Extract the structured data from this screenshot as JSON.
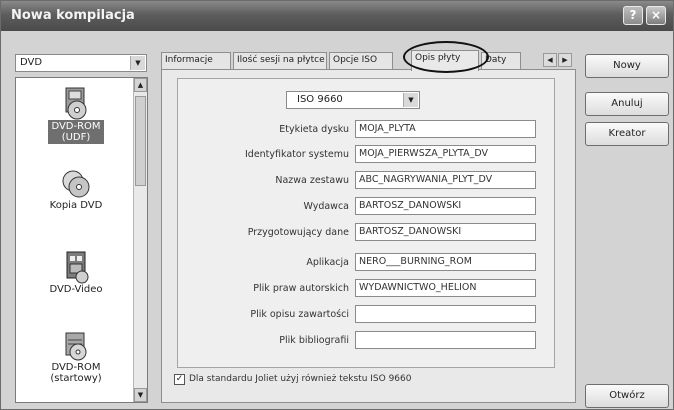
{
  "window": {
    "title": "Nowa kompilacja"
  },
  "disc_type": {
    "value": "DVD"
  },
  "compilation_types": [
    {
      "label_line1": "DVD-ROM",
      "label_line2": "(UDF)",
      "selected": true
    },
    {
      "label_line1": "Kopia DVD",
      "label_line2": ""
    },
    {
      "label_line1": "DVD-Video",
      "label_line2": ""
    },
    {
      "label_line1": "DVD-ROM",
      "label_line2": "(startowy)"
    }
  ],
  "tabs": [
    {
      "label": "Informacje"
    },
    {
      "label": "Ilość sesji na płytce"
    },
    {
      "label": "Opcje ISO"
    },
    {
      "label": "Opis płyty",
      "active": true
    },
    {
      "label": "Daty"
    }
  ],
  "iso": {
    "value": "ISO 9660"
  },
  "fields": [
    {
      "label": "Etykieta dysku",
      "value": "MOJA_PLYTA"
    },
    {
      "label": "Identyfikator systemu",
      "value": "MOJA_PIERWSZA_PLYTA_DV"
    },
    {
      "label": "Nazwa zestawu",
      "value": "ABC_NAGRYWANIA_PLYT_DV"
    },
    {
      "label": "Wydawca",
      "value": "BARTOSZ_DANOWSKI"
    },
    {
      "label": "Przygotowujący dane",
      "value": "BARTOSZ_DANOWSKI"
    },
    {
      "label": "Aplikacja",
      "value": "NERO___BURNING_ROM"
    },
    {
      "label": "Plik praw autorskich",
      "value": "WYDAWNICTWO_HELION"
    },
    {
      "label": "Plik opisu zawartości",
      "value": ""
    },
    {
      "label": "Plik bibliografii",
      "value": ""
    }
  ],
  "checkbox": {
    "label": "Dla standardu Joliet użyj również tekstu ISO 9660",
    "checked": true
  },
  "buttons": {
    "new": "Nowy",
    "cancel": "Anuluj",
    "wizard": "Kreator",
    "open": "Otwórz"
  }
}
